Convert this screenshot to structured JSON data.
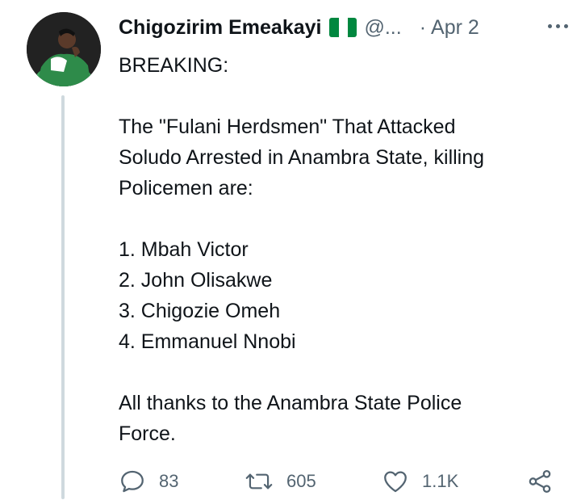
{
  "tweet": {
    "author_name": "Chigozirim Emeakayi",
    "handle": "@...",
    "separator": "·",
    "date": "Apr 2",
    "colors": {
      "flag_green": "#00873f",
      "flag_white": "#ffffff",
      "text": "#0f1419",
      "muted": "#536471",
      "thread_line": "#cfd9de"
    },
    "lines": [
      "BREAKING:",
      "",
      "The \"Fulani Herdsmen\" That Attacked",
      "Soludo Arrested in Anambra State, killing",
      "Policemen are:",
      "",
      "1. Mbah Victor",
      "2. John Olisakwe",
      "3. Chigozie Omeh",
      "4. Emmanuel Nnobi",
      "",
      "All thanks to the Anambra State Police",
      "Force."
    ]
  },
  "actions": {
    "reply_count": "83",
    "retweet_count": "605",
    "like_count": "1.1K",
    "icons": [
      "reply-icon",
      "retweet-icon",
      "like-icon",
      "share-icon"
    ]
  }
}
